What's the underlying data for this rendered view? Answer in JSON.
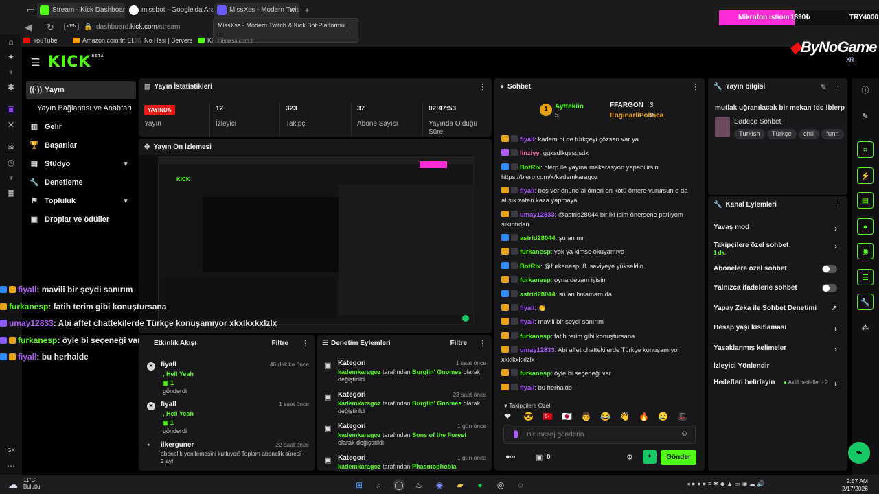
{
  "browser": {
    "tabs": [
      {
        "label": "Stream - Kick Dashboard"
      },
      {
        "label": "missbot - Google'da Ara"
      },
      {
        "label": "MissXss - Modern Twitch"
      }
    ],
    "vpn": "VPN",
    "url_prefix": "dashboard.",
    "url_host": "kick.com",
    "url_path": "/stream",
    "bookmarks": [
      "YouTube",
      "Amazon.com.tr: El...",
      "No Hesi | Servers",
      "Ki"
    ],
    "tooltip_title": "MissXss - Modern Twitch & Kick Bot Platformu | ...",
    "tooltip_url": "missxss.com.tr"
  },
  "stream_overlay": {
    "mic_label": "Mikrofon istiom",
    "mic_amount": "1890₺",
    "try_amount": "TRY4000",
    "sponsor": "ByNoGame",
    "sponsor_sub": "XR"
  },
  "kick": {
    "logo": "KICK",
    "logo_sup": "BETA"
  },
  "nav": {
    "items": [
      {
        "label": "Yayın",
        "icon": "broadcast-icon"
      },
      {
        "label": "Yayın Bağlantısı ve Anahtarı",
        "icon": ""
      },
      {
        "label": "Gelir",
        "icon": "bar-chart-icon"
      },
      {
        "label": "Başarılar",
        "icon": "trophy-icon"
      },
      {
        "label": "Stüdyo",
        "icon": "studio-icon"
      },
      {
        "label": "Denetleme",
        "icon": "wrench-icon"
      },
      {
        "label": "Topluluk",
        "icon": "community-icon"
      },
      {
        "label": "Droplar ve ödüller",
        "icon": "gift-icon"
      }
    ]
  },
  "stats": {
    "title": "Yayın İstatistikleri",
    "live": "YAYINDA",
    "live_label": "Yayın",
    "items": [
      {
        "value": "12",
        "label": "İzleyici"
      },
      {
        "value": "323",
        "label": "Takipçi"
      },
      {
        "value": "37",
        "label": "Abone Sayısı"
      },
      {
        "value": "02:47:53",
        "label": "Yayında Olduğu Süre"
      }
    ]
  },
  "preview": {
    "title": "Yayın Ön İzlemesi"
  },
  "overlay_chat": [
    {
      "user": "fiyall",
      "text": ": mavili bir şeydi sanırım",
      "color": "#b05cff"
    },
    {
      "user": "furkanesp",
      "text": ": fatih terim gibi konuştursana",
      "color": "#53fc18"
    },
    {
      "user": "umay12833",
      "text": ": Abi affet chattekilerde Türkçe konuşamıyor xkxlkxkxlzlx",
      "color": "#b05cff"
    },
    {
      "user": "furkanesp",
      "text": ": öyle bi seçeneği var",
      "color": "#53fc18"
    },
    {
      "user": "fiyall",
      "text": ": bu herhalde",
      "color": "#b05cff"
    }
  ],
  "activity": {
    "title": "Etkinlik Akışı",
    "filter": "Filtre",
    "items": [
      {
        "name": "fiyall",
        "time": "48 dakika önce",
        "l1": ", Hell Yeah",
        "l2": "1",
        "l3": "gönderdi"
      },
      {
        "name": "fiyall",
        "time": "1 saat önce",
        "l1": ", Hell Yeah",
        "l2": "1",
        "l3": "gönderdi"
      },
      {
        "name": "ilkerguner",
        "time": "22 saat önce",
        "l1": "abonelik yenilemesini kutluyor! Toplam abonelik süresi - 2 ay!",
        "l2": "",
        "l3": ""
      }
    ]
  },
  "moderation": {
    "title": "Denetim Eylemleri",
    "filter": "Filtre",
    "items": [
      {
        "name": "Kategori",
        "time": "1 saat önce",
        "user": "kademkaragoz",
        "mid": " tarafından ",
        "target": "Burglin' Gnomes",
        "end": " olarak değiştirildi"
      },
      {
        "name": "Kategori",
        "time": "23 saat önce",
        "user": "kademkaragoz",
        "mid": " tarafından ",
        "target": "Burglin' Gnomes",
        "end": " olarak değiştirildi"
      },
      {
        "name": "Kategori",
        "time": "1 gün önce",
        "user": "kademkaragoz",
        "mid": " tarafından ",
        "target": "Sons of the Forest",
        "end": " olarak değiştirildi"
      },
      {
        "name": "Kategori",
        "time": "1 gün önce",
        "user": "kademkaragoz",
        "mid": " tarafından ",
        "target": "Phasmophobia",
        "end": ""
      }
    ]
  },
  "chat": {
    "title": "Sohbet",
    "podium": [
      {
        "name": "Ayttekiin",
        "count": "5",
        "rank": "1"
      },
      {
        "name": "FFARGON",
        "count": "3",
        "rank": "2"
      },
      {
        "name": "EnginarliPohaca",
        "count": "2",
        "rank": "3"
      }
    ],
    "messages": [
      {
        "user": "fiyall",
        "text": ": kadem bi de türkçeyi çözsen var ya",
        "color": "#b05cff",
        "badge": "#e8a317"
      },
      {
        "user": "linziyy",
        "text": ": ggksdlkgssgsdk",
        "color": "#ff6fa8",
        "badge": "#b05cff"
      },
      {
        "user": "BotRix",
        "text": ": blerp ile yayına makarasyon yapabilirsin",
        "link": "https://blerp.com/x/kademkaragoz",
        "color": "#53fc18",
        "badge": "#2f8cff"
      },
      {
        "user": "fiyall",
        "text": ": boş ver önüne al ömeri en kötü ömere vurursun o da alışık zaten kaza yapmaya",
        "color": "#b05cff",
        "badge": "#e8a317"
      },
      {
        "user": "umay12833",
        "text": ": @astrid28044 bir iki isim önersene patlıyom sıkıntıdan",
        "color": "#b05cff",
        "badge": "#e8a317"
      },
      {
        "user": "astrid28044",
        "text": ": şu an mı",
        "color": "#53fc18",
        "badge": "#2f8cff"
      },
      {
        "user": "furkanesp",
        "text": ": yok ya kimse okuyamıyo",
        "color": "#53fc18",
        "badge": "#e8a317"
      },
      {
        "user": "BotRix",
        "text": ": @furkanesp, 8. seviyeye yükseldin.",
        "color": "#53fc18",
        "badge": "#2f8cff"
      },
      {
        "user": "furkanesp",
        "text": ": oyna devam iyisin",
        "color": "#53fc18",
        "badge": "#e8a317"
      },
      {
        "user": "astrid28044",
        "text": ": su an bulamam da",
        "color": "#53fc18",
        "badge": "#2f8cff"
      },
      {
        "user": "fiyall",
        "text": ": 👏",
        "color": "#b05cff",
        "badge": "#e8a317"
      },
      {
        "user": "fiyall",
        "text": ": mavili bir şeydi sanırım",
        "color": "#b05cff",
        "badge": "#e8a317"
      },
      {
        "user": "furkanesp",
        "text": ": fatih terim gibi konuştursana",
        "color": "#53fc18",
        "badge": "#e8a317"
      },
      {
        "user": "umay12833",
        "text": ": Abi affet chattekilerde Türkçe konuşamıyor xkxlkxkxlzlx",
        "color": "#b05cff",
        "badge": "#e8a317"
      },
      {
        "user": "furkanesp",
        "text": ": öyle bi seçeneği var",
        "color": "#53fc18",
        "badge": "#e8a317"
      },
      {
        "user": "fiyall",
        "text": ": bu herhalde",
        "color": "#b05cff",
        "badge": "#e8a317"
      }
    ],
    "followers_only": "Takipçilere Özel",
    "emotes": [
      "❤",
      "😎",
      "🇹🇷",
      "🇯🇵",
      "👨",
      "😂",
      "👋",
      "🔥",
      "😢",
      "🎩"
    ],
    "placeholder": "Bir mesaj gönderin",
    "points": "0",
    "send": "Gönder"
  },
  "stream_info": {
    "title": "Yayın bilgisi",
    "stream_title": "mutlak uğranılacak bir mekan !dc !blerp",
    "category": "Sadece Sohbet",
    "tags": [
      "Turkish",
      "Türkçe",
      "chill",
      "funn"
    ]
  },
  "channel_actions": {
    "title": "Kanal Eylemleri",
    "items": [
      {
        "label": "Yavaş mod",
        "sub": "",
        "type": "chevron"
      },
      {
        "label": "Takipçilere özel sohbet",
        "sub": "1 dk.",
        "type": "chevron"
      },
      {
        "label": "Abonelere özel sohbet",
        "sub": "",
        "type": "toggle"
      },
      {
        "label": "Yalnızca ifadelerle sohbet",
        "sub": "",
        "type": "toggle"
      },
      {
        "label": "Yapay Zeka ile Sohbet Denetimi",
        "sub": "",
        "type": "external"
      },
      {
        "label": "Hesap yaşı kısıtlaması",
        "sub": "",
        "type": "chevron"
      },
      {
        "label": "Yasaklanmış kelimeler",
        "sub": "",
        "type": "chevron"
      },
      {
        "label": "İzleyici Yönlendir",
        "sub": "",
        "type": "none"
      },
      {
        "label": "Hedefleri belirleyin",
        "sub": "",
        "type": "goals"
      }
    ],
    "goals_status": "Aktif hedefler - 2"
  },
  "taskbar": {
    "temp": "11°C",
    "weather": "Bulutlu",
    "time": "2:57 AM",
    "date": "2/17/2026",
    "tray_label": "GX"
  }
}
